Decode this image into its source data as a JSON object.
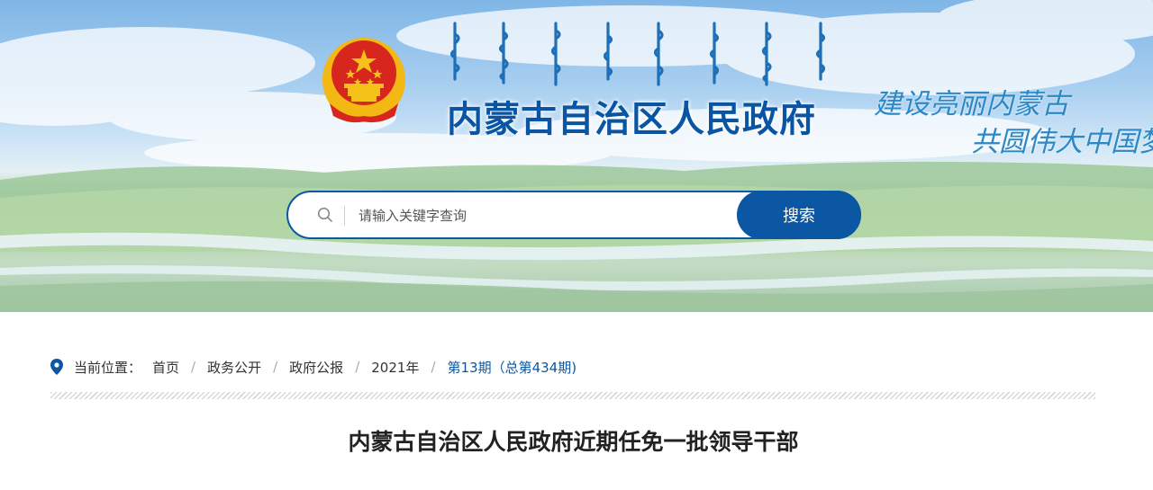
{
  "header": {
    "title_mongolian": "ᠦᠪᠦᠷ ᠮᠣᠩᠭᠣᠯ ᠤᠨ ᠥᠪᠡᠷᠲᠡᠭᠡᠨ ᠵᠠᠰᠠᠬᠤ ᠣᠷᠣᠨ ᠤ ᠠᠷᠠᠳ ᠤᠨ ᠵᠠᠰᠠᠭ ᠤᠨ ᠭᠠᠵᠠᠷ",
    "title": "内蒙古自治区人民政府",
    "slogan_line1": "建设亮丽内蒙古",
    "slogan_line2": "共圆伟大中国梦"
  },
  "search": {
    "placeholder": "请输入关键字查询",
    "button_label": "搜索",
    "icon": "search-icon"
  },
  "breadcrumb": {
    "icon": "location-pin-icon",
    "label": "当前位置：",
    "items": [
      "首页",
      "政务公开",
      "政府公报",
      "2021年",
      "第13期（总第434期)"
    ]
  },
  "article": {
    "title": "内蒙古自治区人民政府近期任免一批领导干部"
  },
  "colors": {
    "brand_blue": "#0b57a4",
    "slogan_blue": "#2e88c4",
    "emblem_red": "#d7261e",
    "emblem_gold": "#f5c21a"
  }
}
